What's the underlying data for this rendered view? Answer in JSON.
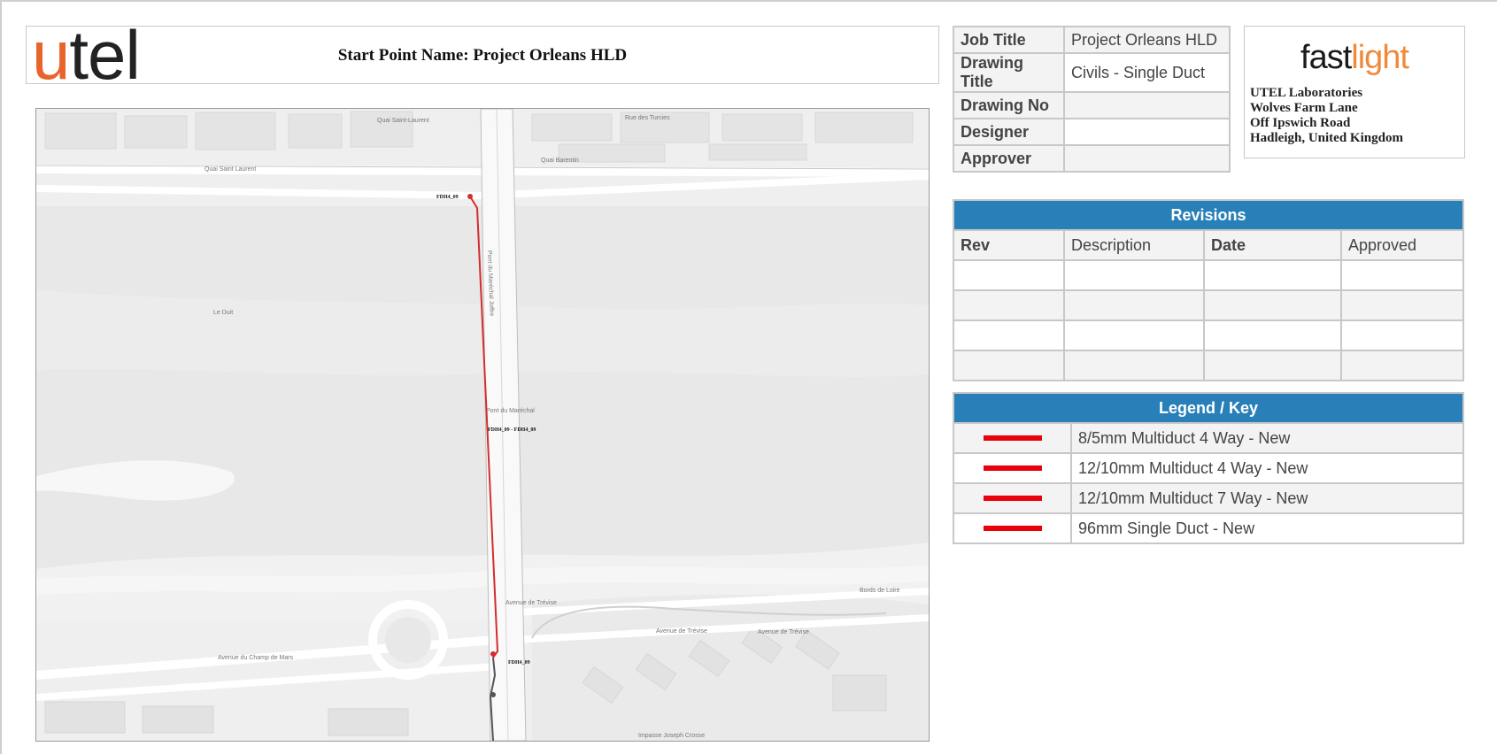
{
  "header": {
    "logo_u": "u",
    "logo_rest": "tel",
    "start_point_title": "Start Point Name: Project Orleans HLD"
  },
  "info": {
    "rows": [
      {
        "label": "Job Title",
        "value": "Project Orleans HLD"
      },
      {
        "label": "Drawing Title",
        "value": "Civils - Single Duct"
      },
      {
        "label": "Drawing No",
        "value": ""
      },
      {
        "label": "Designer",
        "value": ""
      },
      {
        "label": "Approver",
        "value": ""
      }
    ]
  },
  "company": {
    "logo_part1": "fast",
    "logo_part2": "light",
    "address": [
      "UTEL Laboratories",
      "Wolves Farm Lane",
      "Off Ipswich Road",
      "Hadleigh, United Kingdom"
    ]
  },
  "revisions": {
    "title": "Revisions",
    "columns": [
      "Rev",
      "Description",
      "Date",
      "Approved"
    ]
  },
  "legend": {
    "title": "Legend / Key",
    "items": [
      {
        "label": "8/5mm Multiduct 4 Way - New",
        "color": "#e8000b"
      },
      {
        "label": "12/10mm Multiduct 4 Way - New",
        "color": "#e8000b"
      },
      {
        "label": "12/10mm Multiduct 7 Way - New",
        "color": "#e8000b"
      },
      {
        "label": "96mm Single Duct - New",
        "color": "#e8000b"
      }
    ]
  },
  "map": {
    "node_labels": [
      "FDH4_09",
      "FDH4_09 - FDH4_09",
      "FDH4_09"
    ],
    "street_labels": [
      "Quai Saint-Laurent",
      "Quai Saint Laurent",
      "Rue des Turcies",
      "Quai Barentin",
      "Pont du Maréchal Joffre",
      "Le Duit",
      "Pont du Maréchal",
      "Avenue de Trévise",
      "Avenue du Champ de Mars",
      "Avenue de Trévise",
      "Bords de Loire",
      "Impasse Joseph Crosse",
      "Avenue de Trévise"
    ],
    "route_color": "#d42d2d"
  }
}
